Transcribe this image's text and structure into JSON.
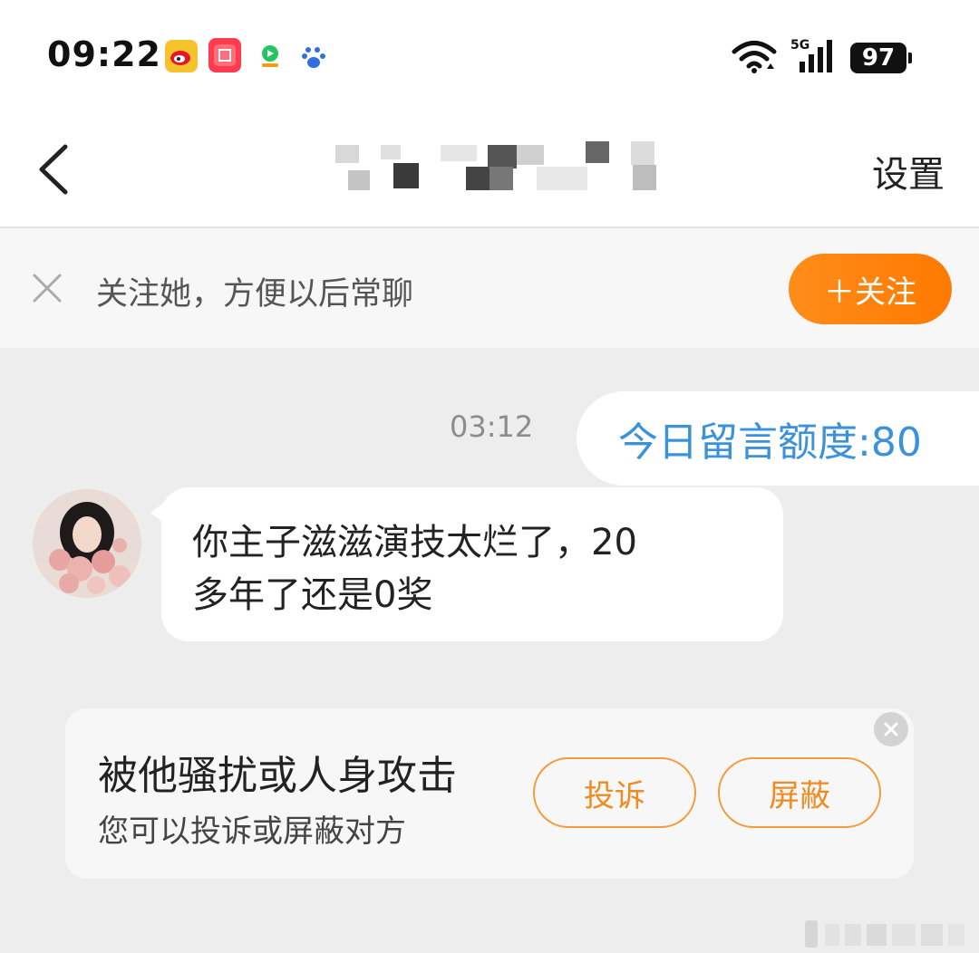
{
  "status_bar": {
    "time": "09:22",
    "apps": [
      "weibo-app-icon",
      "taobao-app-icon",
      "video-app-icon",
      "baidu-app-icon"
    ],
    "network": "5G",
    "battery": "97"
  },
  "header": {
    "back_icon": "chevron-left-icon",
    "settings_label": "设置"
  },
  "follow_bar": {
    "text": "关注她，方便以后常聊",
    "button_label": "＋关注"
  },
  "chat": {
    "timestamp": "03:12",
    "outgoing_message": "今日留言额度:80",
    "incoming_message_line1": "你主子滋滋演技太烂了，20",
    "incoming_message_line2": "多年了还是0奖"
  },
  "report_card": {
    "title": "被他骚扰或人身攻击",
    "subtitle": "您可以投诉或屏蔽对方",
    "complain_label": "投诉",
    "block_label": "屏蔽"
  },
  "colors": {
    "accent_orange": "#ff8000",
    "link_blue": "#3b92db",
    "background": "#ededed"
  }
}
